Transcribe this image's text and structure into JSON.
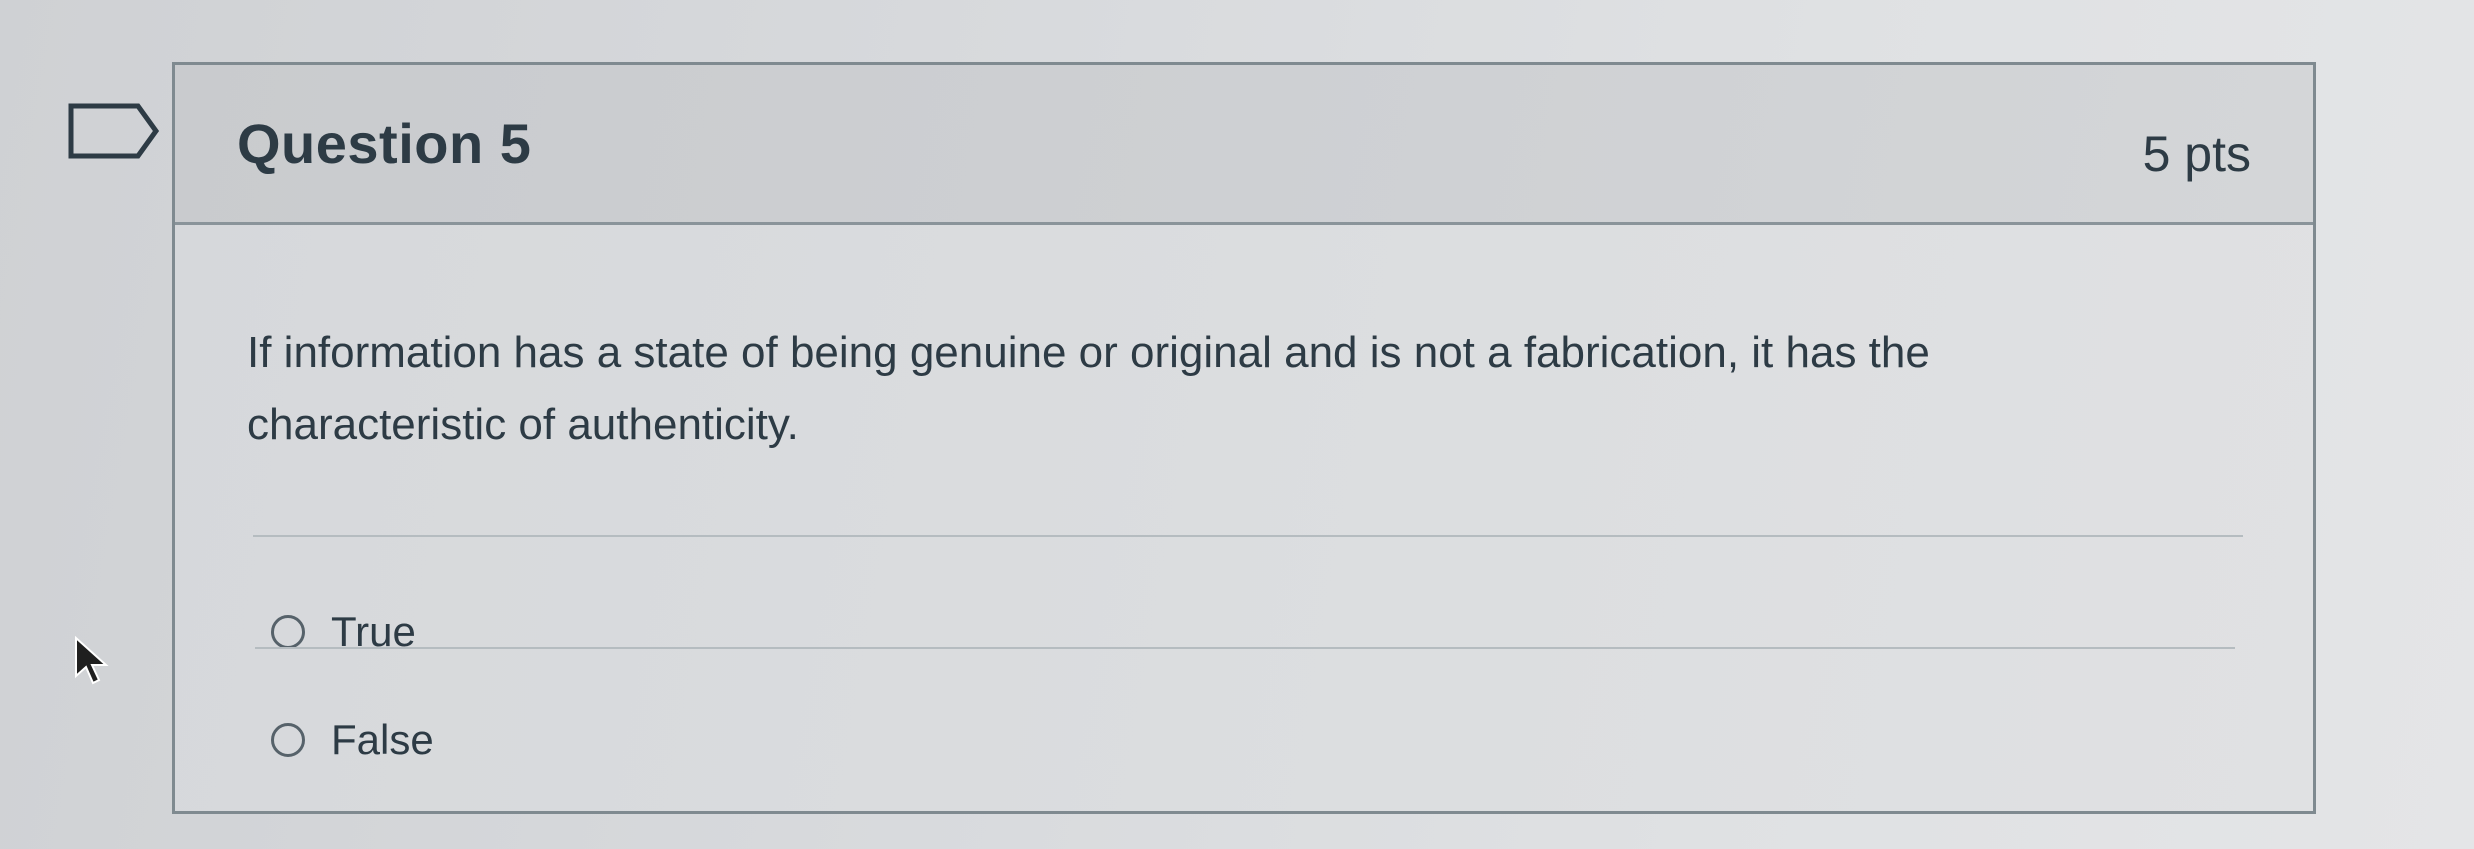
{
  "question": {
    "title": "Question 5",
    "points": "5 pts",
    "text": "If information has a state of being genuine or original and is not a fabrication, it has the characteristic of authenticity.",
    "answers": [
      {
        "label": "True",
        "selected": false
      },
      {
        "label": "False",
        "selected": false
      }
    ]
  },
  "icons": {
    "flag": "flag-outline-icon",
    "cursor": "mouse-pointer-icon"
  },
  "colors": {
    "text": "#2d3b45",
    "border": "#7f8a90"
  }
}
